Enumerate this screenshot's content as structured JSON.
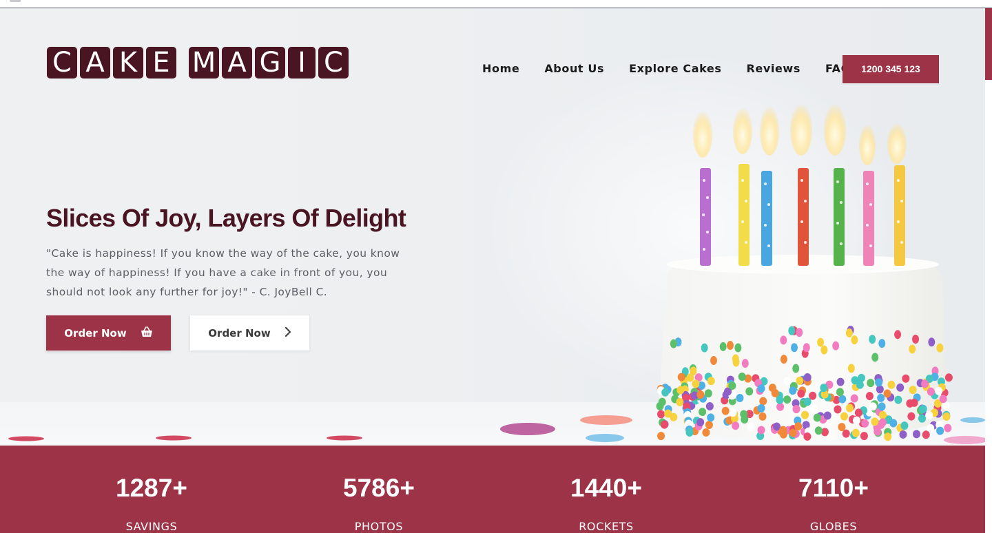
{
  "brand": {
    "logo_words": [
      [
        "C",
        "A",
        "K",
        "E"
      ],
      [
        "M",
        "A",
        "G",
        "I",
        "C"
      ]
    ],
    "logo_text": "CAKE MAGIC"
  },
  "nav": {
    "items": [
      "Home",
      "About Us",
      "Explore Cakes",
      "Reviews",
      "FAQ"
    ],
    "phone": "1200 345 123"
  },
  "hero": {
    "title": "Slices Of Joy, Layers Of Delight",
    "quote": "\"Cake is happiness! If you know the way of the cake, you know the way of happiness! If you have a cake in front of you, you should not look any further for joy!\" - C. JoyBell C.",
    "primary_button": "Order Now",
    "primary_icon": "basket-icon",
    "secondary_button": "Order Now",
    "secondary_icon": "chevron-right-icon",
    "image_icon": "birthday-cake-image"
  },
  "stats": [
    {
      "value": "1287+",
      "label": "SAVINGS"
    },
    {
      "value": "5786+",
      "label": "PHOTOS"
    },
    {
      "value": "1440+",
      "label": "ROCKETS"
    },
    {
      "value": "7110+",
      "label": "GLOBES"
    }
  ],
  "colors": {
    "accent": "#9c3346",
    "brand_dark": "#4a1522",
    "hero_bg": "#eef0f2"
  }
}
